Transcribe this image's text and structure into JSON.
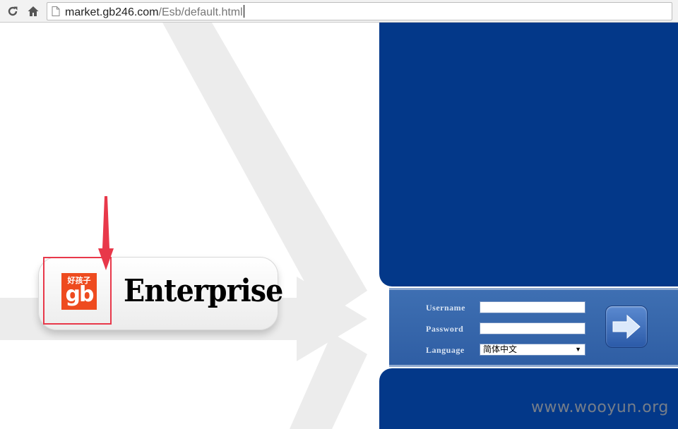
{
  "browser": {
    "url_host": "market.gb246.com",
    "url_path": "/Esb/default.html",
    "icons": {
      "reload": "reload-icon",
      "home": "home-icon",
      "page": "page-icon"
    }
  },
  "card": {
    "logo_top": "好孩子",
    "logo_main": "gb",
    "title": "Enterprise"
  },
  "login": {
    "username_label": "Username",
    "password_label": "Password",
    "language_label": "Language",
    "username_value": "",
    "password_value": "",
    "language_value": "简体中文",
    "submit_icon": "arrow-right-icon"
  },
  "watermark": "www.wooyun.org",
  "colors": {
    "panel_blue": "#033889",
    "band_blue": "#3566ac",
    "logo_orange": "#ee4b1f",
    "annotation_red": "#e8384a"
  }
}
